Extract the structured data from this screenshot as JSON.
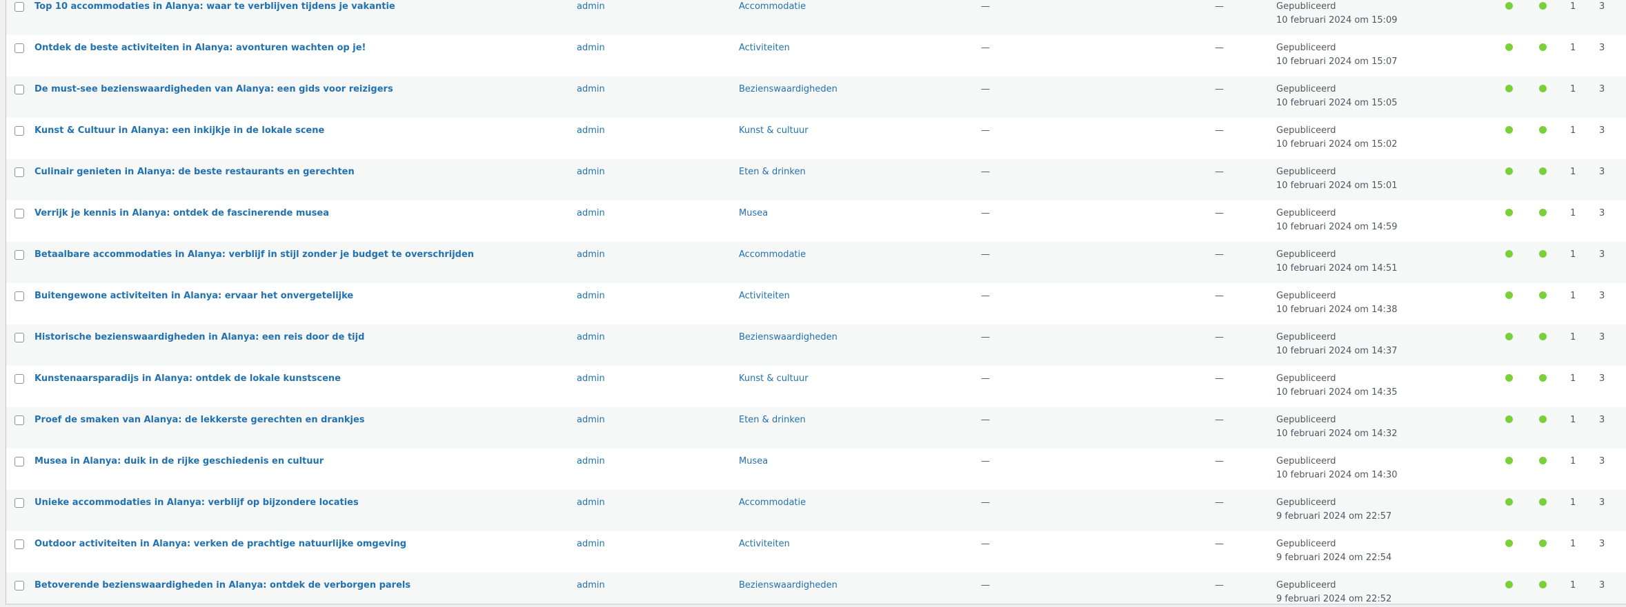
{
  "colors": {
    "link": "#2271b1",
    "text": "#50575e",
    "status_dot": "#7ad03a",
    "row_alt": "#f6f7f7",
    "row_plain": "#ffffff"
  },
  "posts": [
    {
      "title": "Top 10 accommodaties in Alanya: waar te verblijven tijdens je vakantie",
      "author": "admin",
      "category": "Accommodatie",
      "tags": "—",
      "comments": "—",
      "status": "Gepubliceerd",
      "date": "10 februari 2024 om 15:09",
      "count_a": "1",
      "count_b": "3"
    },
    {
      "title": "Ontdek de beste activiteiten in Alanya: avonturen wachten op je!",
      "author": "admin",
      "category": "Activiteiten",
      "tags": "—",
      "comments": "—",
      "status": "Gepubliceerd",
      "date": "10 februari 2024 om 15:07",
      "count_a": "1",
      "count_b": "3"
    },
    {
      "title": "De must-see bezienswaardigheden van Alanya: een gids voor reizigers",
      "author": "admin",
      "category": "Bezienswaardigheden",
      "tags": "—",
      "comments": "—",
      "status": "Gepubliceerd",
      "date": "10 februari 2024 om 15:05",
      "count_a": "1",
      "count_b": "3"
    },
    {
      "title": "Kunst & Cultuur in Alanya: een inkijkje in de lokale scene",
      "author": "admin",
      "category": "Kunst & cultuur",
      "tags": "—",
      "comments": "—",
      "status": "Gepubliceerd",
      "date": "10 februari 2024 om 15:02",
      "count_a": "1",
      "count_b": "3"
    },
    {
      "title": "Culinair genieten in Alanya: de beste restaurants en gerechten",
      "author": "admin",
      "category": "Eten & drinken",
      "tags": "—",
      "comments": "—",
      "status": "Gepubliceerd",
      "date": "10 februari 2024 om 15:01",
      "count_a": "1",
      "count_b": "3"
    },
    {
      "title": "Verrijk je kennis in Alanya: ontdek de fascinerende musea",
      "author": "admin",
      "category": "Musea",
      "tags": "—",
      "comments": "—",
      "status": "Gepubliceerd",
      "date": "10 februari 2024 om 14:59",
      "count_a": "1",
      "count_b": "3"
    },
    {
      "title": "Betaalbare accommodaties in Alanya: verblijf in stijl zonder je budget te overschrijden",
      "author": "admin",
      "category": "Accommodatie",
      "tags": "—",
      "comments": "—",
      "status": "Gepubliceerd",
      "date": "10 februari 2024 om 14:51",
      "count_a": "1",
      "count_b": "3"
    },
    {
      "title": "Buitengewone activiteiten in Alanya: ervaar het onvergetelijke",
      "author": "admin",
      "category": "Activiteiten",
      "tags": "—",
      "comments": "—",
      "status": "Gepubliceerd",
      "date": "10 februari 2024 om 14:38",
      "count_a": "1",
      "count_b": "3"
    },
    {
      "title": "Historische bezienswaardigheden in Alanya: een reis door de tijd",
      "author": "admin",
      "category": "Bezienswaardigheden",
      "tags": "—",
      "comments": "—",
      "status": "Gepubliceerd",
      "date": "10 februari 2024 om 14:37",
      "count_a": "1",
      "count_b": "3"
    },
    {
      "title": "Kunstenaarsparadijs in Alanya: ontdek de lokale kunstscene",
      "author": "admin",
      "category": "Kunst & cultuur",
      "tags": "—",
      "comments": "—",
      "status": "Gepubliceerd",
      "date": "10 februari 2024 om 14:35",
      "count_a": "1",
      "count_b": "3"
    },
    {
      "title": "Proef de smaken van Alanya: de lekkerste gerechten en drankjes",
      "author": "admin",
      "category": "Eten & drinken",
      "tags": "—",
      "comments": "—",
      "status": "Gepubliceerd",
      "date": "10 februari 2024 om 14:32",
      "count_a": "1",
      "count_b": "3"
    },
    {
      "title": "Musea in Alanya: duik in de rijke geschiedenis en cultuur",
      "author": "admin",
      "category": "Musea",
      "tags": "—",
      "comments": "—",
      "status": "Gepubliceerd",
      "date": "10 februari 2024 om 14:30",
      "count_a": "1",
      "count_b": "3"
    },
    {
      "title": "Unieke accommodaties in Alanya: verblijf op bijzondere locaties",
      "author": "admin",
      "category": "Accommodatie",
      "tags": "—",
      "comments": "—",
      "status": "Gepubliceerd",
      "date": "9 februari 2024 om 22:57",
      "count_a": "1",
      "count_b": "3"
    },
    {
      "title": "Outdoor activiteiten in Alanya: verken de prachtige natuurlijke omgeving",
      "author": "admin",
      "category": "Activiteiten",
      "tags": "—",
      "comments": "—",
      "status": "Gepubliceerd",
      "date": "9 februari 2024 om 22:54",
      "count_a": "1",
      "count_b": "3"
    },
    {
      "title": "Betoverende bezienswaardigheden in Alanya: ontdek de verborgen parels",
      "author": "admin",
      "category": "Bezienswaardigheden",
      "tags": "—",
      "comments": "—",
      "status": "Gepubliceerd",
      "date": "9 februari 2024 om 22:52",
      "count_a": "1",
      "count_b": "3"
    }
  ]
}
